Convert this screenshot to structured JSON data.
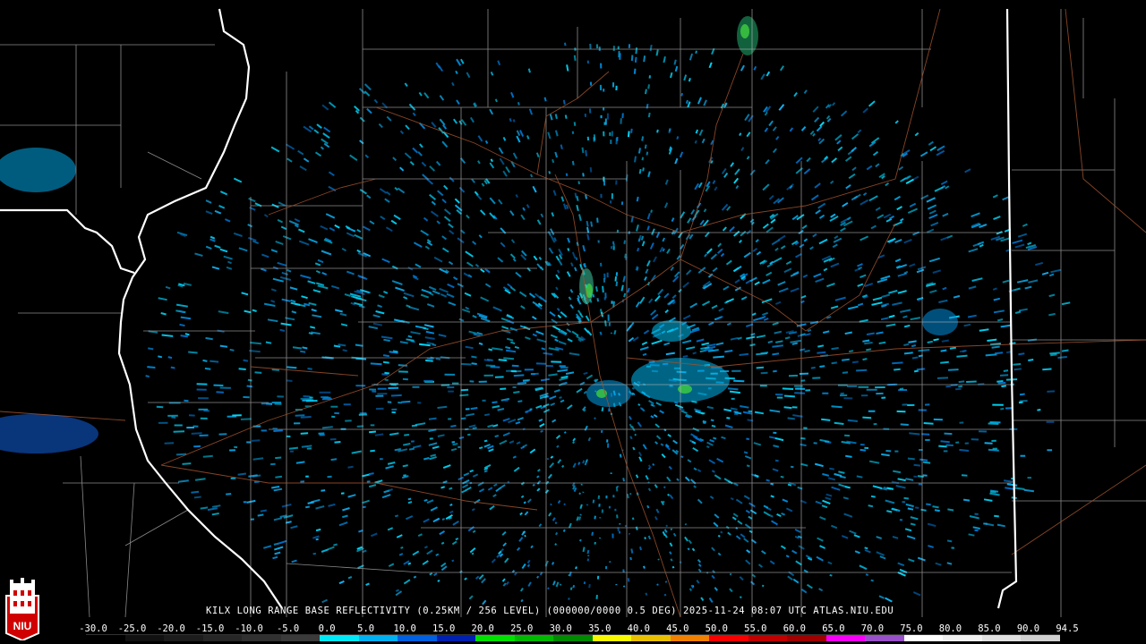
{
  "caption": "KILX LONG RANGE BASE REFLECTIVITY (0.25KM / 256 LEVEL) (000000/0000 0.5 DEG) 2025-11-24 08:07 UTC  ATLAS.NIU.EDU",
  "logo": {
    "text": "NIU",
    "icon": "niu-logo-icon"
  },
  "scale": {
    "labels": [
      "-30.0",
      "-25.0",
      "-20.0",
      "-15.0",
      "-10.0",
      "-5.0",
      "0.0",
      "5.0",
      "10.0",
      "15.0",
      "20.0",
      "25.0",
      "30.0",
      "35.0",
      "40.0",
      "45.0",
      "50.0",
      "55.0",
      "60.0",
      "65.0",
      "70.0",
      "75.0",
      "80.0",
      "85.0",
      "90.0",
      "94.5"
    ],
    "colors": [
      "#000000",
      "#111111",
      "#1c1c1c",
      "#262626",
      "#303030",
      "#3a3a3a",
      "#00e8f8",
      "#00b0f0",
      "#0060e0",
      "#0020b0",
      "#00e000",
      "#00b800",
      "#008a00",
      "#f8f800",
      "#e8c000",
      "#f08000",
      "#f80000",
      "#c00000",
      "#a00000",
      "#f800f8",
      "#9850c8",
      "#ffffff",
      "#f0f0f0",
      "#e0e0e0",
      "#d0d0d0"
    ]
  },
  "colors": {
    "state_border": "#ffffff",
    "county_border": "#b8b8b8",
    "highway": "#a0522d",
    "background": "#000000"
  }
}
